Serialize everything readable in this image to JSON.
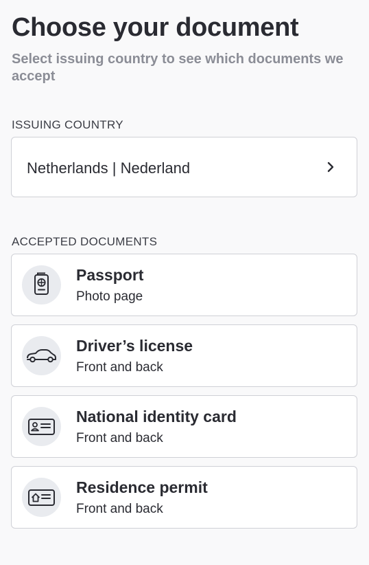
{
  "header": {
    "title": "Choose your document",
    "subtitle": "Select issuing country to see which documents we accept"
  },
  "country": {
    "label": "ISSUING COUNTRY",
    "value": "Netherlands | Nederland",
    "icon": "chevron-right-icon"
  },
  "documents": {
    "label": "ACCEPTED DOCUMENTS",
    "items": [
      {
        "name": "Passport",
        "detail": "Photo page",
        "icon": "passport-icon"
      },
      {
        "name": "Driver’s license",
        "detail": "Front and back",
        "icon": "car-icon"
      },
      {
        "name": "National identity card",
        "detail": "Front and back",
        "icon": "id-card-icon"
      },
      {
        "name": "Residence permit",
        "detail": "Front and back",
        "icon": "residence-permit-icon"
      }
    ]
  }
}
